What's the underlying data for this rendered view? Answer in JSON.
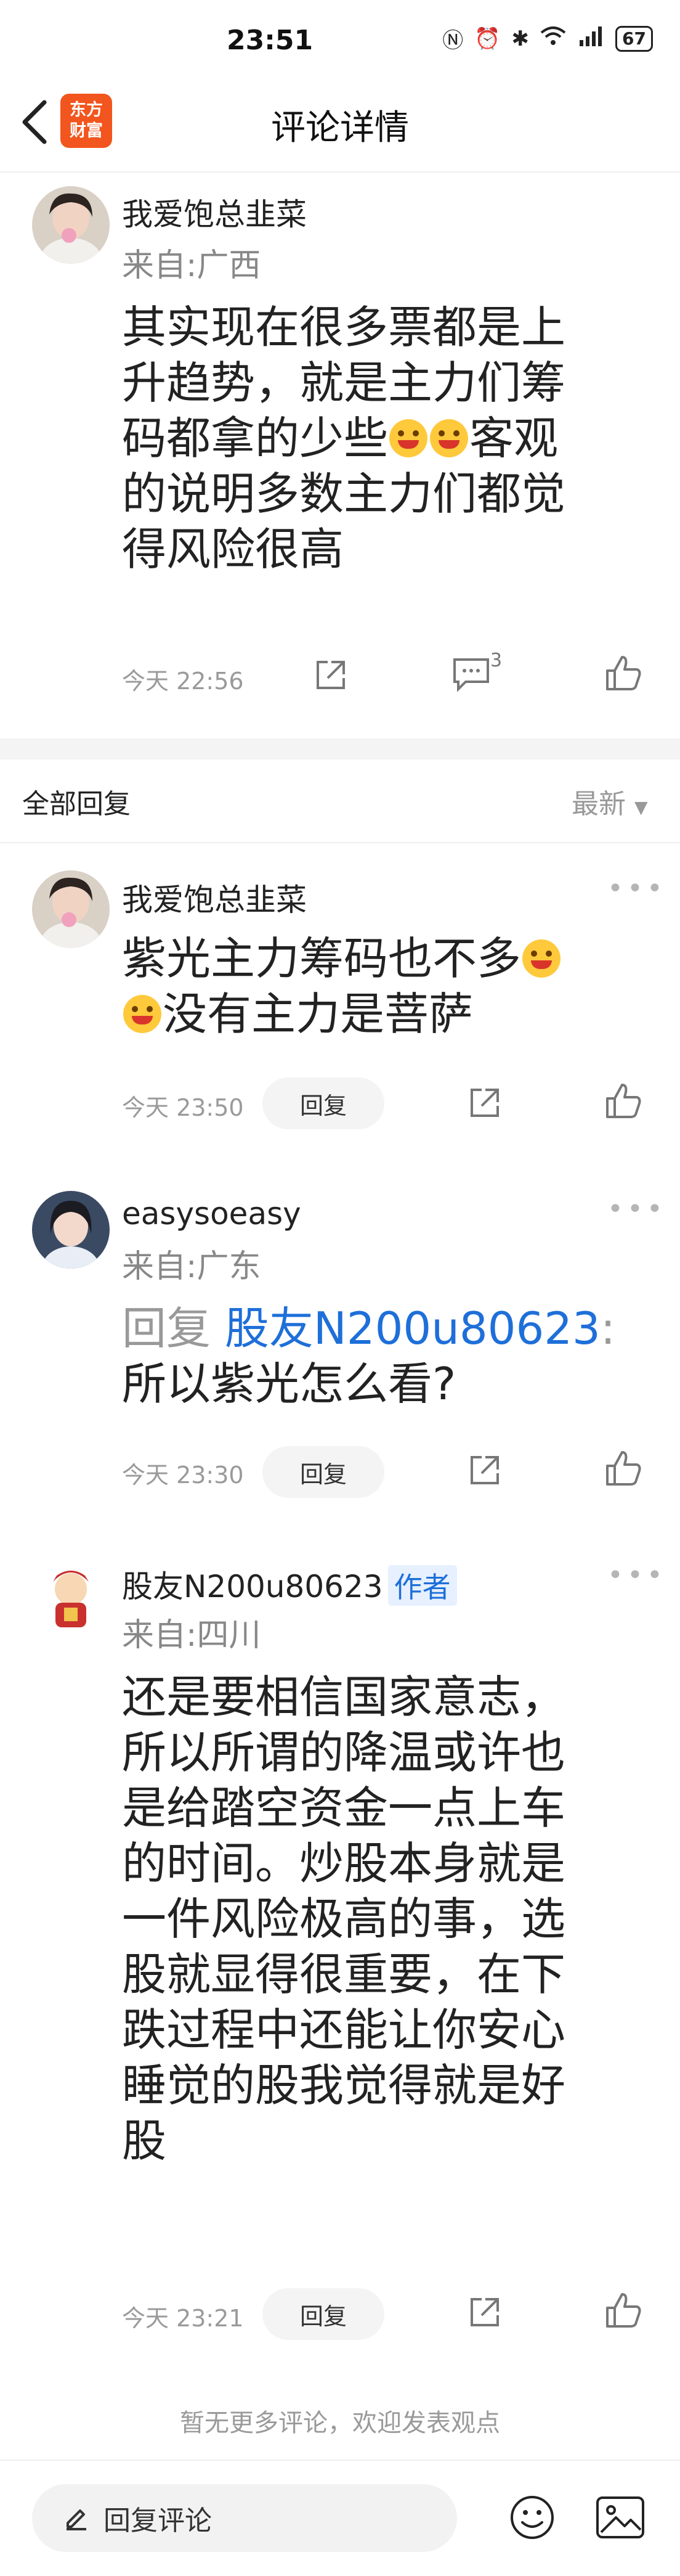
{
  "status_bar": {
    "time": "23:51",
    "battery": "67",
    "icons": [
      "nfc-icon",
      "alarm-icon",
      "bluetooth-icon",
      "wifi-icon",
      "signal-5g-icon",
      "battery-icon"
    ]
  },
  "nav": {
    "logo_line1": "东方",
    "logo_line2": "财富",
    "title": "评论详情"
  },
  "main_comment": {
    "username": "我爱饱总韭菜",
    "location": "来自:广西",
    "content_part1": "其实现在很多票都是上",
    "content_part2": "升趋势，就是主力们筹",
    "content_part3a": "码都拿的少些",
    "content_part3b": "客观",
    "content_part4": "的说明多数主力们都觉",
    "content_part5": "得风险很高",
    "time": "今天 22:56",
    "comment_count": "3"
  },
  "replies_header": {
    "title": "全部回复",
    "sort": "最新"
  },
  "replies": [
    {
      "username": "我爱饱总韭菜",
      "line1": "紫光主力筹码也不多",
      "line2": "没有主力是菩萨",
      "time": "今天 23:50",
      "reply_label": "回复"
    },
    {
      "username": "easysoeasy",
      "location": "来自:广东",
      "reply_prefix": "回复",
      "reply_to": "股友N200u80623",
      "reply_colon": ":",
      "line2": "所以紫光怎么看?",
      "time": "今天 23:30",
      "reply_label": "回复"
    },
    {
      "username": "股友N200u80623",
      "badge": "作者",
      "location": "来自:四川",
      "lines": [
        "还是要相信国家意志，",
        "所以所谓的降温或许也",
        "是给踏空资金一点上车",
        "的时间。炒股本身就是",
        "一件风险极高的事，选",
        "股就显得很重要，在下",
        "跌过程中还能让你安心",
        "睡觉的股我觉得就是好",
        "股"
      ],
      "time": "今天 23:21",
      "reply_label": "回复"
    }
  ],
  "footer_note": "暂无更多评论，欢迎发表观点",
  "bottom_bar": {
    "input_placeholder": "回复评论"
  },
  "colors": {
    "brand": "#f2551d",
    "link": "#1e6fd9",
    "muted": "#999999"
  }
}
